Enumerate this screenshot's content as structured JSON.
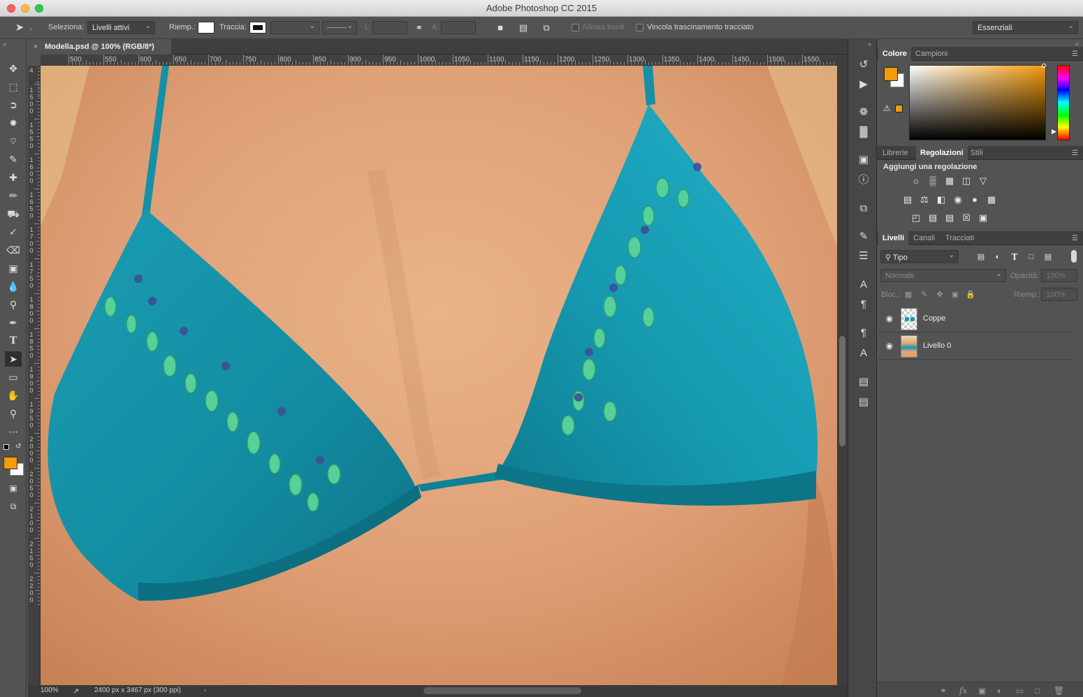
{
  "window": {
    "title": "Adobe Photoshop CC 2015"
  },
  "options": {
    "seleziona_label": "Seleziona:",
    "seleziona_value": "Livelli attivi",
    "riemp_label": "Riemp.:",
    "traccia_label": "Traccia:",
    "l_label": "L:",
    "a_label": "A:",
    "allinea": "Allinea bordi",
    "vincola": "Vincola trascinamento tracciato",
    "workspace": "Essenziali"
  },
  "document": {
    "tab_title": "Modella.psd @ 100% (RGB/8*)",
    "zoom": "100%",
    "doc_info": "2400 px x 3467 px (300 ppi)",
    "ruler_h": [
      "500",
      "550",
      "600",
      "650",
      "700",
      "750",
      "800",
      "850",
      "900",
      "950",
      "1000",
      "1050",
      "1100",
      "1150",
      "1200",
      "1250",
      "1300",
      "1350",
      "1400",
      "1450",
      "1500",
      "1550"
    ],
    "ruler_v": [
      "4",
      "1500",
      "1550",
      "1600",
      "1650",
      "1700",
      "1750",
      "1800",
      "1850",
      "1900",
      "1950",
      "2000",
      "2050",
      "2100",
      "2150",
      "2200"
    ]
  },
  "panels": {
    "color_tabs": [
      "Colore",
      "Campioni"
    ],
    "adj_tabs": [
      "Librerie",
      "Regolazioni",
      "Stili"
    ],
    "adj_title": "Aggiungi una regolazione",
    "layers_tabs": [
      "Livelli",
      "Canali",
      "Tracciati"
    ],
    "filter": "Tipo",
    "blend": "Normale",
    "opacity_label": "Opacità:",
    "opacity_value": "100%",
    "lock_label": "Bloc.:",
    "fill_label": "Riemp.:",
    "fill_value": "100%",
    "layers": [
      "Coppe",
      "Livello 0"
    ]
  },
  "colors": {
    "foreground": "#f39a0d",
    "background": "#ffffff",
    "accent": "#149aaf"
  }
}
